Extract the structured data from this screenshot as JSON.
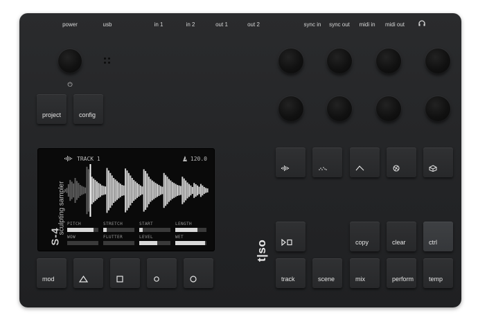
{
  "ports": [
    "power",
    "usb",
    "in 1",
    "in 2",
    "out 1",
    "out 2",
    "sync in",
    "sync out",
    "midi in",
    "midi out"
  ],
  "power_symbol": "⏻",
  "top_buttons": {
    "project": "project",
    "config": "config"
  },
  "screen": {
    "track": "TRACK 1",
    "bpm": "120.0",
    "vertical_label": "sculpting sampler",
    "model": "S-4",
    "params": [
      {
        "label": "PITCH",
        "value": 0.85
      },
      {
        "label": "STRETCH",
        "value": 0.12
      },
      {
        "label": "START",
        "value": 0.1
      },
      {
        "label": "LENGTH",
        "value": 0.72
      },
      {
        "label": "WOW",
        "value": 0.0
      },
      {
        "label": "FLUTTER",
        "value": 0.0
      },
      {
        "label": "LEVEL",
        "value": 0.58
      },
      {
        "label": "WET",
        "value": 0.96
      }
    ],
    "waveform": [
      0.05,
      0.1,
      0.25,
      0.42,
      0.35,
      0.28,
      0.5,
      0.38,
      0.3,
      0.22,
      0.18,
      0.15,
      0.12,
      0.95,
      0.85,
      0.7,
      0.55,
      0.48,
      0.42,
      0.36,
      0.3,
      0.26,
      0.2,
      0.18,
      0.16,
      0.9,
      0.8,
      0.7,
      0.6,
      0.5,
      0.44,
      0.38,
      0.32,
      0.27,
      0.22,
      0.2,
      0.88,
      0.8,
      0.7,
      0.6,
      0.5,
      0.42,
      0.36,
      0.3,
      0.25,
      0.2,
      0.16,
      0.85,
      0.78,
      0.68,
      0.55,
      0.46,
      0.4,
      0.35,
      0.3,
      0.26,
      0.22,
      0.18,
      0.15,
      0.7,
      0.62,
      0.55,
      0.46,
      0.4,
      0.34,
      0.3,
      0.26,
      0.22,
      0.2,
      0.18,
      0.55,
      0.48,
      0.4,
      0.32,
      0.26,
      0.2,
      0.14,
      0.3,
      0.25,
      0.2,
      0.15,
      0.26,
      0.2,
      0.14,
      0.1,
      0.08
    ],
    "playhead": 0.18
  },
  "bottom_left_buttons": [
    {
      "name": "mod-button",
      "label": "mod"
    },
    {
      "name": "triangle-button",
      "label": "",
      "icon": "triangle-icon"
    },
    {
      "name": "square-button",
      "label": "",
      "icon": "square-icon"
    },
    {
      "name": "circle-small-button",
      "label": "",
      "icon": "circle-small-icon"
    },
    {
      "name": "circle-button",
      "label": "",
      "icon": "circle-icon"
    }
  ],
  "brand": "t|so",
  "mode_buttons": [
    {
      "name": "waveform-mode-button",
      "icon": "waveform-icon"
    },
    {
      "name": "grain-mode-button",
      "icon": "grain-icon"
    },
    {
      "name": "envelope-mode-button",
      "icon": "envelope-icon"
    },
    {
      "name": "loop-mode-button",
      "icon": "loop-icon"
    },
    {
      "name": "cube-mode-button",
      "icon": "cube-icon"
    }
  ],
  "row3_buttons": {
    "copy": "copy",
    "clear": "clear",
    "ctrl": "ctrl"
  },
  "row4_buttons": {
    "track": "track",
    "scene": "scene",
    "mix": "mix",
    "perform": "perform",
    "temp": "temp"
  }
}
